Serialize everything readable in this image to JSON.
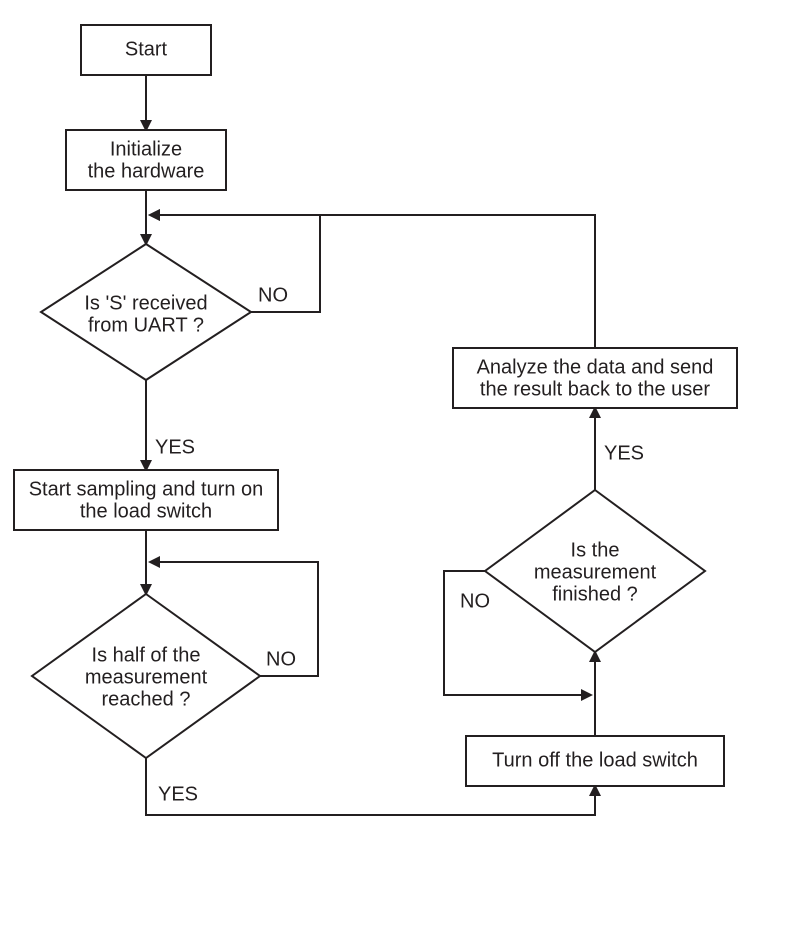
{
  "flowchart": {
    "nodes": {
      "start": {
        "label": "Start"
      },
      "init": {
        "line1": "Initialize",
        "line2": "the hardware"
      },
      "decision_s": {
        "line1": "Is 'S' received",
        "line2": "from UART ?"
      },
      "start_sampling": {
        "line1": "Start sampling and turn on",
        "line2": "the load switch"
      },
      "decision_half": {
        "line1": "Is half of the",
        "line2": "measurement",
        "line3": "reached ?"
      },
      "turn_off": {
        "label": "Turn off the load switch"
      },
      "decision_finished": {
        "line1": "Is the",
        "line2": "measurement",
        "line3": "finished ?"
      },
      "analyze": {
        "line1": "Analyze the data and send",
        "line2": "the result back to the user"
      }
    },
    "edge_labels": {
      "yes": "YES",
      "no": "NO"
    }
  }
}
